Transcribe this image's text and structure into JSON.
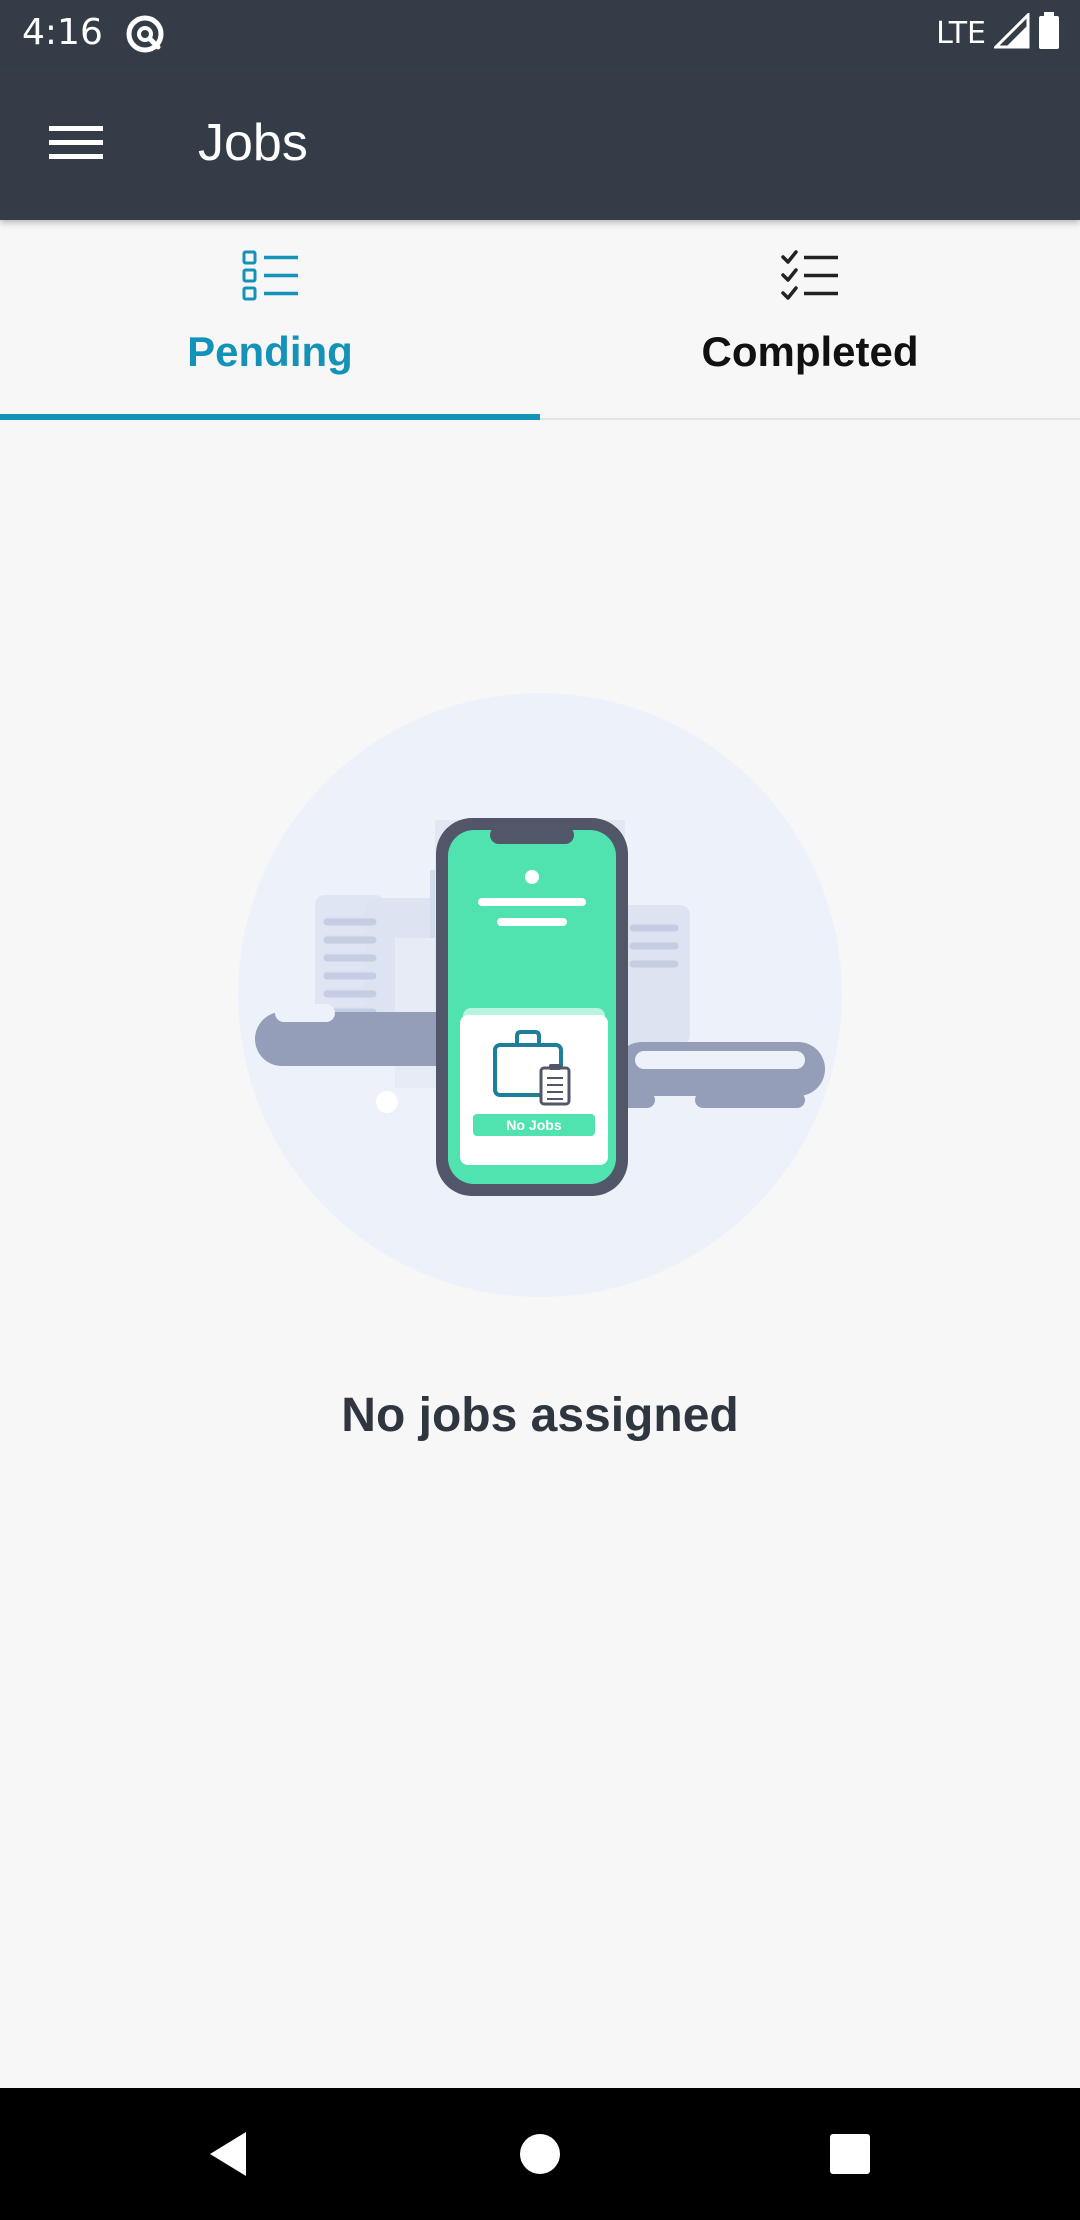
{
  "status_bar": {
    "time": "4:16",
    "network": "LTE"
  },
  "app_bar": {
    "title": "Jobs",
    "menu_icon": "hamburger-menu-icon"
  },
  "tabs": [
    {
      "label": "Pending",
      "icon": "list-icon",
      "active": true
    },
    {
      "label": "Completed",
      "icon": "checklist-icon",
      "active": false
    }
  ],
  "empty_state": {
    "illustration_caption": "No Jobs",
    "message": "No jobs assigned"
  },
  "colors": {
    "app_bar": "#343d47",
    "accent": "#1592b8",
    "background": "#f7f7f7",
    "illustration_green": "#50e3b0"
  },
  "nav_bar": {
    "back_icon": "back-triangle-icon",
    "home_icon": "home-circle-icon",
    "recents_icon": "recents-square-icon"
  }
}
